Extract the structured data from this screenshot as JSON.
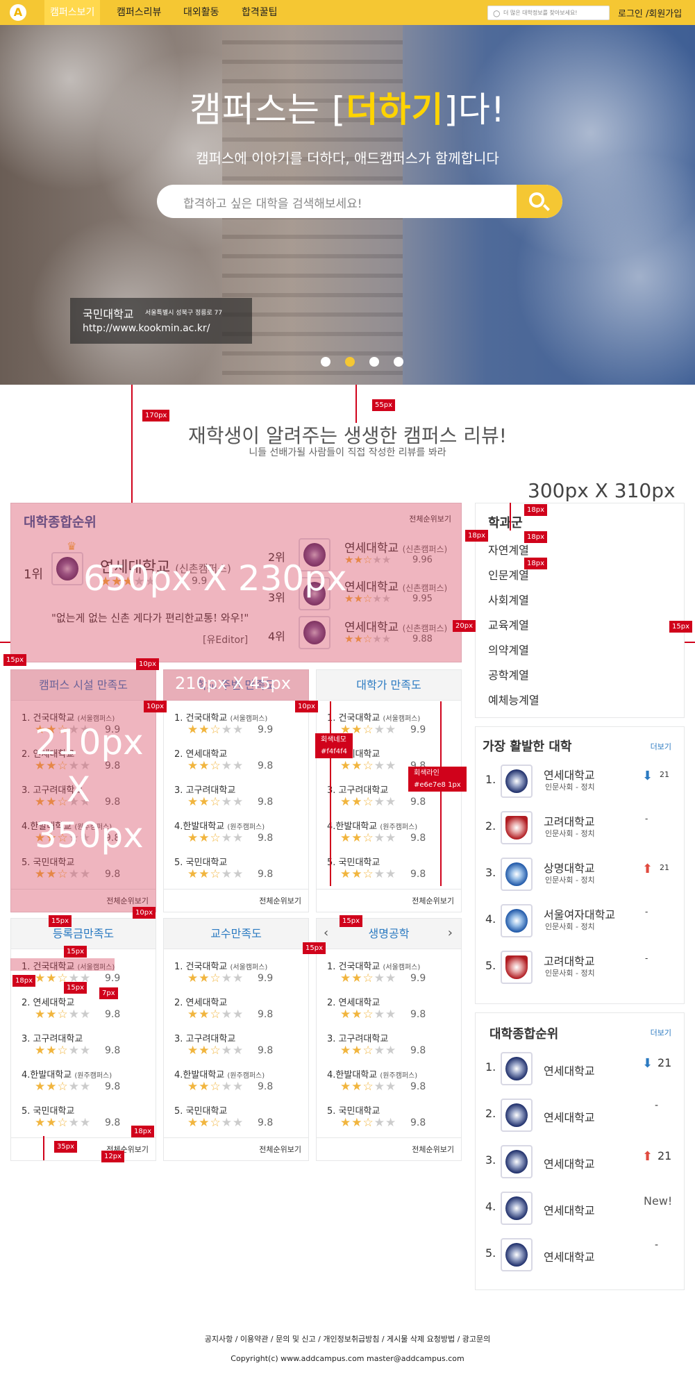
{
  "header": {
    "logo": "A",
    "nav": [
      "캠퍼스보기",
      "캠퍼스리뷰",
      "대외활동",
      "합격꿀팁"
    ],
    "search_placeholder": "더 많은 대학정보를 찾아보세요!",
    "login": "로그인 /회원가입"
  },
  "hero": {
    "title_pre": "캠퍼스는 [",
    "title_hl": "더하기",
    "title_post": "]다!",
    "subtitle": "캠퍼스에 이야기를 더하다, 애드캠퍼스가 함께합니다",
    "search_placeholder": "합격하고 싶은 대학을 검색해보세요!",
    "caption": {
      "name": "국민대학교",
      "address": "서울특별시 성북구 정릉로 77",
      "url": "http://www.kookmin.ac.kr/"
    }
  },
  "section": {
    "title": "재학생이 알려주는 생생한 캠퍼스 리뷰!",
    "subtitle": "니들 선배가될 사람들이 직접 작성한 리뷰를 봐라"
  },
  "main_ranking": {
    "title": "대학종합순위",
    "more": "전체순위보기",
    "first": {
      "rank": "1위",
      "name": "연세대학교",
      "campus": "(신촌캠퍼스)",
      "score": "9.9",
      "quote": "\"없는게 없는 신촌 게다가 편리한교통! 와우!\"",
      "editor": "[유Editor]"
    },
    "others": [
      {
        "rank": "2위",
        "name": "연세대학교",
        "campus": "(신촌캠퍼스)",
        "score": "9.96"
      },
      {
        "rank": "3위",
        "name": "연세대학교",
        "campus": "(신촌캠퍼스)",
        "score": "9.95"
      },
      {
        "rank": "4위",
        "name": "연세대학교",
        "campus": "(신촌캠퍼스)",
        "score": "9.88"
      }
    ]
  },
  "cards": [
    {
      "title": "캠퍼스 시설 만족도",
      "more": "전체순위보기"
    },
    {
      "title": "학교 주변 만족도",
      "more": "전체순위보기"
    },
    {
      "title": "대학가 만족도",
      "more": "전체순위보기"
    },
    {
      "title": "등록금만족도",
      "more": "전체순위보기"
    },
    {
      "title": "교수만족도",
      "more": "전체순위보기"
    },
    {
      "title": "생명공학",
      "more": "전체순위보기"
    }
  ],
  "card_rows": [
    {
      "label": "1. 건국대학교",
      "campus": "(서울캠퍼스)",
      "score": "9.9"
    },
    {
      "label": "2. 연세대학교",
      "campus": "",
      "score": "9.8"
    },
    {
      "label": "3. 고구려대학교",
      "campus": "",
      "score": "9.8"
    },
    {
      "label": "4.한발대학교",
      "campus": "(원주캠퍼스)",
      "score": "9.8"
    },
    {
      "label": "5. 국민대학교",
      "campus": "",
      "score": "9.8"
    }
  ],
  "sidebar_dept": {
    "title": "학과군",
    "items": [
      "자연계열",
      "인문계열",
      "사회계열",
      "교육계열",
      "의약계열",
      "공학계열",
      "예체능계열"
    ]
  },
  "active_univ": {
    "title": "가장 활발한 대학",
    "more": "더보기",
    "items": [
      {
        "rank": "1.",
        "name": "연세대학교",
        "dept": "인문사회 - 정치",
        "change": "21"
      },
      {
        "rank": "2.",
        "name": "고려대학교",
        "dept": "인문사회 - 정치",
        "change": "-"
      },
      {
        "rank": "3.",
        "name": "상명대학교",
        "dept": "인문사회 - 정치",
        "change": "21"
      },
      {
        "rank": "4.",
        "name": "서울여자대학교",
        "dept": "인문사회 - 정치",
        "change": "-"
      },
      {
        "rank": "5.",
        "name": "고려대학교",
        "dept": "인문사회 - 정치",
        "change": "-"
      }
    ]
  },
  "overall_rank": {
    "title": "대학종합순위",
    "more": "더보기",
    "items": [
      {
        "rank": "1.",
        "name": "연세대학교",
        "change": "21"
      },
      {
        "rank": "2.",
        "name": "연세대학교",
        "change": "-"
      },
      {
        "rank": "3.",
        "name": "연세대학교",
        "change": "21"
      },
      {
        "rank": "4.",
        "name": "연세대학교",
        "change": "New!"
      },
      {
        "rank": "5.",
        "name": "연세대학교",
        "change": "-"
      }
    ]
  },
  "annotations": {
    "a170": "170px",
    "a55": "55px",
    "a300": "300px X 310px",
    "a18a": "18px",
    "a18b": "18px",
    "a18c": "18px",
    "a18d": "18px",
    "a650": "650px X 230px",
    "a20": "20px",
    "a15a": "15px",
    "a15b": "15px",
    "a10a": "10px",
    "a210x45": "210px X 45px",
    "a10b": "10px",
    "a10c": "10px",
    "a210": "210px",
    "ax": "X",
    "a350": "350px",
    "gray_box": "회색네모",
    "gray_box_val": "#f4f4f4",
    "gray_line": "회색라인",
    "gray_line_val": "#e6e7e8 1px",
    "a10d": "10px",
    "a15c": "15px",
    "a15d": "15px",
    "a15e": "15px",
    "a15f": "15px",
    "a15g": "15px",
    "a18e": "18px",
    "a7": "7px",
    "a35": "35px",
    "a18f": "18px",
    "a12": "12px"
  },
  "footer": {
    "links": "공지사항  /  이용약관  /  문의 및 신고  /  개인정보취급방침  /  게시물 삭제 요청방법  /  광고문의",
    "copy": "Copyright(c) www.addcampus.com    master@addcampus.com"
  }
}
